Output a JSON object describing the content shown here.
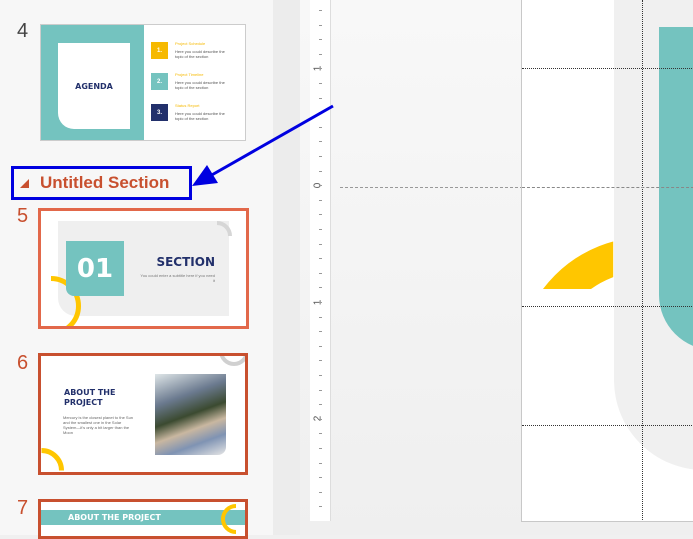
{
  "slides": [
    {
      "number": "4",
      "title": "AGENDA",
      "items": [
        {
          "num": "1.",
          "heading": "Project Schedule",
          "text": "Here you could describe the topic of the section",
          "color": "#f6b900"
        },
        {
          "num": "2.",
          "heading": "Project Timeline",
          "text": "Here you could describe the topic of the section",
          "color": "#74c3bf"
        },
        {
          "num": "3.",
          "heading": "Status Report",
          "text": "Here you could describe the topic of the section",
          "color": "#22306b"
        }
      ]
    },
    {
      "number": "5",
      "big": "01",
      "title": "SECTION",
      "subtitle": "You could enter a subtitle here if you need it"
    },
    {
      "number": "6",
      "title": "ABOUT THE PROJECT",
      "text": "Mercury is the closest planet to the Sun and the smallest one in the Solar System—it's only a bit larger than the Moon"
    },
    {
      "number": "7",
      "title": "ABOUT THE PROJECT"
    }
  ],
  "section": {
    "label": "Untitled Section"
  },
  "ruler": {
    "labels": [
      "1",
      "0",
      "1",
      "2"
    ]
  },
  "colors": {
    "teal": "#74c3bf",
    "yellow": "#ffc600",
    "navy": "#22306b",
    "accent": "#c8502f",
    "annotation": "#0000e0"
  }
}
